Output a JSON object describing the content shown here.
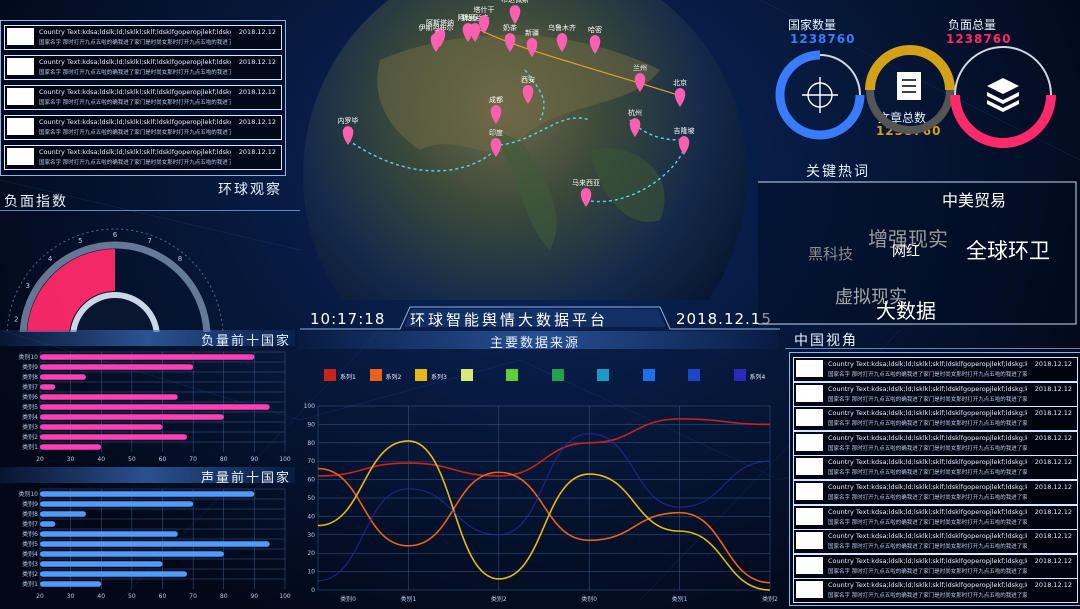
{
  "header": {
    "time": "10:17:18",
    "title": "环球智能舆情大数据平台",
    "date": "2018.12.15"
  },
  "news_left": {
    "items": [
      {
        "line1": "Country  Text:kdsa;ldslk;ld;lsklkl;sklf;ldsklfgoperopjlekf;ldskg;kdsg;lkfekd",
        "line2": "国家名字  那时打开九点五啦的确我进了家门是时尚女那时打开九点五啦的我进了家门",
        "date": "2018.12.12"
      },
      {
        "line1": "Country  Text:kdsa;ldslk;ld;lsklkl;sklf;ldsklfgoperopjlekf;ldskg;kdsg;lkfekd",
        "line2": "国家名字  那时打开九点五啦的确我进了家门是时尚女那时打开九点五啦的我进了家门",
        "date": "2018.12.12"
      },
      {
        "line1": "Country  Text:kdsa;ldslk;ld;lsklkl;sklf;ldsklfgoperopjlekf;ldskg;kdsg;lkfekd",
        "line2": "国家名字  那时打开九点五啦的确我进了家门是时尚女那时打开九点五啦的我进了家门",
        "date": "2018.12.12"
      },
      {
        "line1": "Country  Text:kdsa;ldslk;ld;lsklkl;sklf;ldsklfgoperopjlekf;ldskg;kdsg;lkfekd",
        "line2": "国家名字  那时打开九点五啦的确我进了家门是时尚女那时打开九点五啦的我进了家门",
        "date": "2018.12.12"
      },
      {
        "line1": "Country  Text:kdsa;ldslk;ld;lsklkl;sklf;ldsklfgoperopjlekf;ldskg;kdsg;lkfekd",
        "line2": "国家名字  那时打开九点五啦的确我进了家门是时尚女那时打开九点五啦的我进了家门",
        "date": "2018.12.12"
      }
    ]
  },
  "negative_index": {
    "title": "负面指数",
    "gauge_ticks": [
      "2",
      "3",
      "4",
      "5",
      "6",
      "7",
      "8"
    ],
    "value_fraction": 0.5,
    "color": "#ff2a6a"
  },
  "globe": {
    "title": "环球观察",
    "pins": [
      "西安",
      "新疆",
      "奶茶",
      "阿勒泰",
      "乌鲁木齐",
      "哈密",
      "兰州",
      "北京",
      "成都",
      "杭州",
      "印度",
      "马来西亚",
      "吉隆坡",
      "斯里兰卡",
      "内罗毕",
      "阿斯塔纳",
      "塔什干",
      "布达佩斯",
      "伊斯坦布尔"
    ],
    "pin_color": "#ff5fb0"
  },
  "stats": {
    "country_count_label": "国家数量",
    "country_count_value": "1238760",
    "negative_total_label": "负面总量",
    "negative_total_value": "1238760",
    "article_total_label": "文章总数",
    "article_total_value": "1238760",
    "colors": {
      "blue": "#3a7cff",
      "gold": "#d4a017",
      "red": "#ff2a6a"
    }
  },
  "keywords": {
    "title": "关键热词",
    "words": [
      "中美贸易",
      "增强现实",
      "网红",
      "黑科技",
      "全球环卫",
      "虚拟现实",
      "大数据"
    ]
  },
  "top10_negative": {
    "title": "负量前十国家",
    "color": "#ff3fb4"
  },
  "top10_volume": {
    "title": "声量前十国家",
    "color": "#4f9bff"
  },
  "main_sources": {
    "title": "主要数据来源",
    "legend": [
      {
        "label": "系列1",
        "color": "#c8251a"
      },
      {
        "label": "系列2",
        "color": "#e8631a"
      },
      {
        "label": "系列3",
        "color": "#e6b81a"
      },
      {
        "label": "",
        "color": "#d9e87a"
      },
      {
        "label": "",
        "color": "#5fcf3c"
      },
      {
        "label": "",
        "color": "#20a34a"
      },
      {
        "label": "",
        "color": "#1a9ac8"
      },
      {
        "label": "",
        "color": "#1f6fe8"
      },
      {
        "label": "",
        "color": "#1e46c8"
      },
      {
        "label": "系列4",
        "color": "#2a2ab8"
      }
    ]
  },
  "china_view": {
    "title": "中国视角",
    "items": [
      {
        "line1": "Country  Text:kdsa;ldslk;ld;lsklkl;sklf;ldsklfgoperopjlekf;ldskg;kdsg;lkfekd",
        "line2": "国家名字  那时打开九点五啦的确我进了家门是时尚女那时打开九点五啦的我进了家门",
        "date": "2018.12.12"
      },
      {
        "line1": "Country  Text:kdsa;ldslk;ld;lsklkl;sklf;ldsklfgoperopjlekf;ldskg;kdsg;lkfekd",
        "line2": "国家名字  那时打开九点五啦的确我进了家门是时尚女那时打开九点五啦的我进了家门",
        "date": "2018.12.12"
      },
      {
        "line1": "Country  Text:kdsa;ldslk;ld;lsklkl;sklf;ldsklfgoperopjlekf;ldskg;kdsg;lkfekd",
        "line2": "国家名字  那时打开九点五啦的确我进了家门是时尚女那时打开九点五啦的我进了家门",
        "date": "2018.12.12"
      },
      {
        "line1": "Country  Text:kdsa;ldslk;ld;lsklkl;sklf;ldsklfgoperopjlekf;ldskg;kdsg;lkfekd",
        "line2": "国家名字  那时打开九点五啦的确我进了家门是时尚女那时打开九点五啦的我进了家门",
        "date": "2018.12.12"
      },
      {
        "line1": "Country  Text:kdsa;ldslk;ld;lsklkl;sklf;ldsklfgoperopjlekf;ldskg;kdsg;lkfekd",
        "line2": "国家名字  那时打开九点五啦的确我进了家门是时尚女那时打开九点五啦的我进了家门",
        "date": "2018.12.12"
      },
      {
        "line1": "Country  Text:kdsa;ldslk;ld;lsklkl;sklf;ldsklfgoperopjlekf;ldskg;kdsg;lkfekd",
        "line2": "国家名字  那时打开九点五啦的确我进了家门是时尚女那时打开九点五啦的我进了家门",
        "date": "2018.12.12"
      },
      {
        "line1": "Country  Text:kdsa;ldslk;ld;lsklkl;sklf;ldsklfgoperopjlekf;ldskg;kdsg;lkfekd",
        "line2": "国家名字  那时打开九点五啦的确我进了家门是时尚女那时打开九点五啦的我进了家门",
        "date": "2018.12.12"
      },
      {
        "line1": "Country  Text:kdsa;ldslk;ld;lsklkl;sklf;ldsklfgoperopjlekf;ldskg;kdsg;lkfekd",
        "line2": "国家名字  那时打开九点五啦的确我进了家门是时尚女那时打开九点五啦的我进了家门",
        "date": "2018.12.12"
      },
      {
        "line1": "Country  Text:kdsa;ldslk;ld;lsklkl;sklf;ldsklfgoperopjlekf;ldskg;kdsg;lkfekd",
        "line2": "国家名字  那时打开九点五啦的确我进了家门是时尚女那时打开九点五啦的我进了家门",
        "date": "2018.12.12"
      },
      {
        "line1": "Country  Text:kdsa;ldslk;ld;lsklkl;sklf;ldsklfgoperopjlekf;ldskg;kdsg;lkfekd",
        "line2": "国家名字  那时打开九点五啦的确我进了家门是时尚女那时打开九点五啦的我进了家门",
        "date": "2018.12.12"
      }
    ]
  },
  "chart_data": [
    {
      "type": "bar",
      "orientation": "horizontal",
      "categories": [
        "类别10",
        "类别9",
        "类别8",
        "类别7",
        "类别6",
        "类别5",
        "类别4",
        "类别3",
        "类别2",
        "类别1"
      ],
      "values": [
        90,
        70,
        35,
        25,
        65,
        95,
        80,
        60,
        68,
        40
      ],
      "xlim": [
        20,
        100
      ],
      "xticks": [
        "20",
        "30",
        "40",
        "50",
        "60",
        "70",
        "80",
        "90",
        "100"
      ],
      "grid": true
    },
    {
      "type": "bar",
      "orientation": "horizontal",
      "categories": [
        "类别10",
        "类别9",
        "类别8",
        "类别7",
        "类别6",
        "类别5",
        "类别4",
        "类别3",
        "类别2",
        "类别1"
      ],
      "values": [
        90,
        70,
        35,
        25,
        65,
        95,
        80,
        60,
        68,
        40
      ],
      "xlim": [
        20,
        100
      ],
      "xticks": [
        "20",
        "30",
        "40",
        "50",
        "60",
        "70",
        "80",
        "90",
        "100"
      ],
      "grid": true
    },
    {
      "type": "line",
      "categories": [
        "类别0",
        "类别1",
        "类别2",
        "类别0",
        "类别1",
        "类别2"
      ],
      "ylim": [
        0,
        100
      ],
      "yticks": [
        "0",
        "10",
        "20",
        "30",
        "40",
        "50",
        "60",
        "70",
        "80",
        "90",
        "100"
      ],
      "grid": true,
      "series": [
        {
          "name": "系列1",
          "color": "#c8251a",
          "values": [
            62,
            69,
            62,
            80,
            93,
            90
          ]
        },
        {
          "name": "系列2",
          "color": "#e8631a",
          "values": [
            66,
            24,
            64,
            27,
            42,
            4
          ]
        },
        {
          "name": "系列3",
          "color": "#e6b81a",
          "values": [
            35,
            81,
            6,
            63,
            32,
            0
          ]
        },
        {
          "name": "系列4",
          "color": "#2a2ab8",
          "values": [
            5,
            55,
            30,
            85,
            45,
            70
          ]
        }
      ]
    }
  ]
}
